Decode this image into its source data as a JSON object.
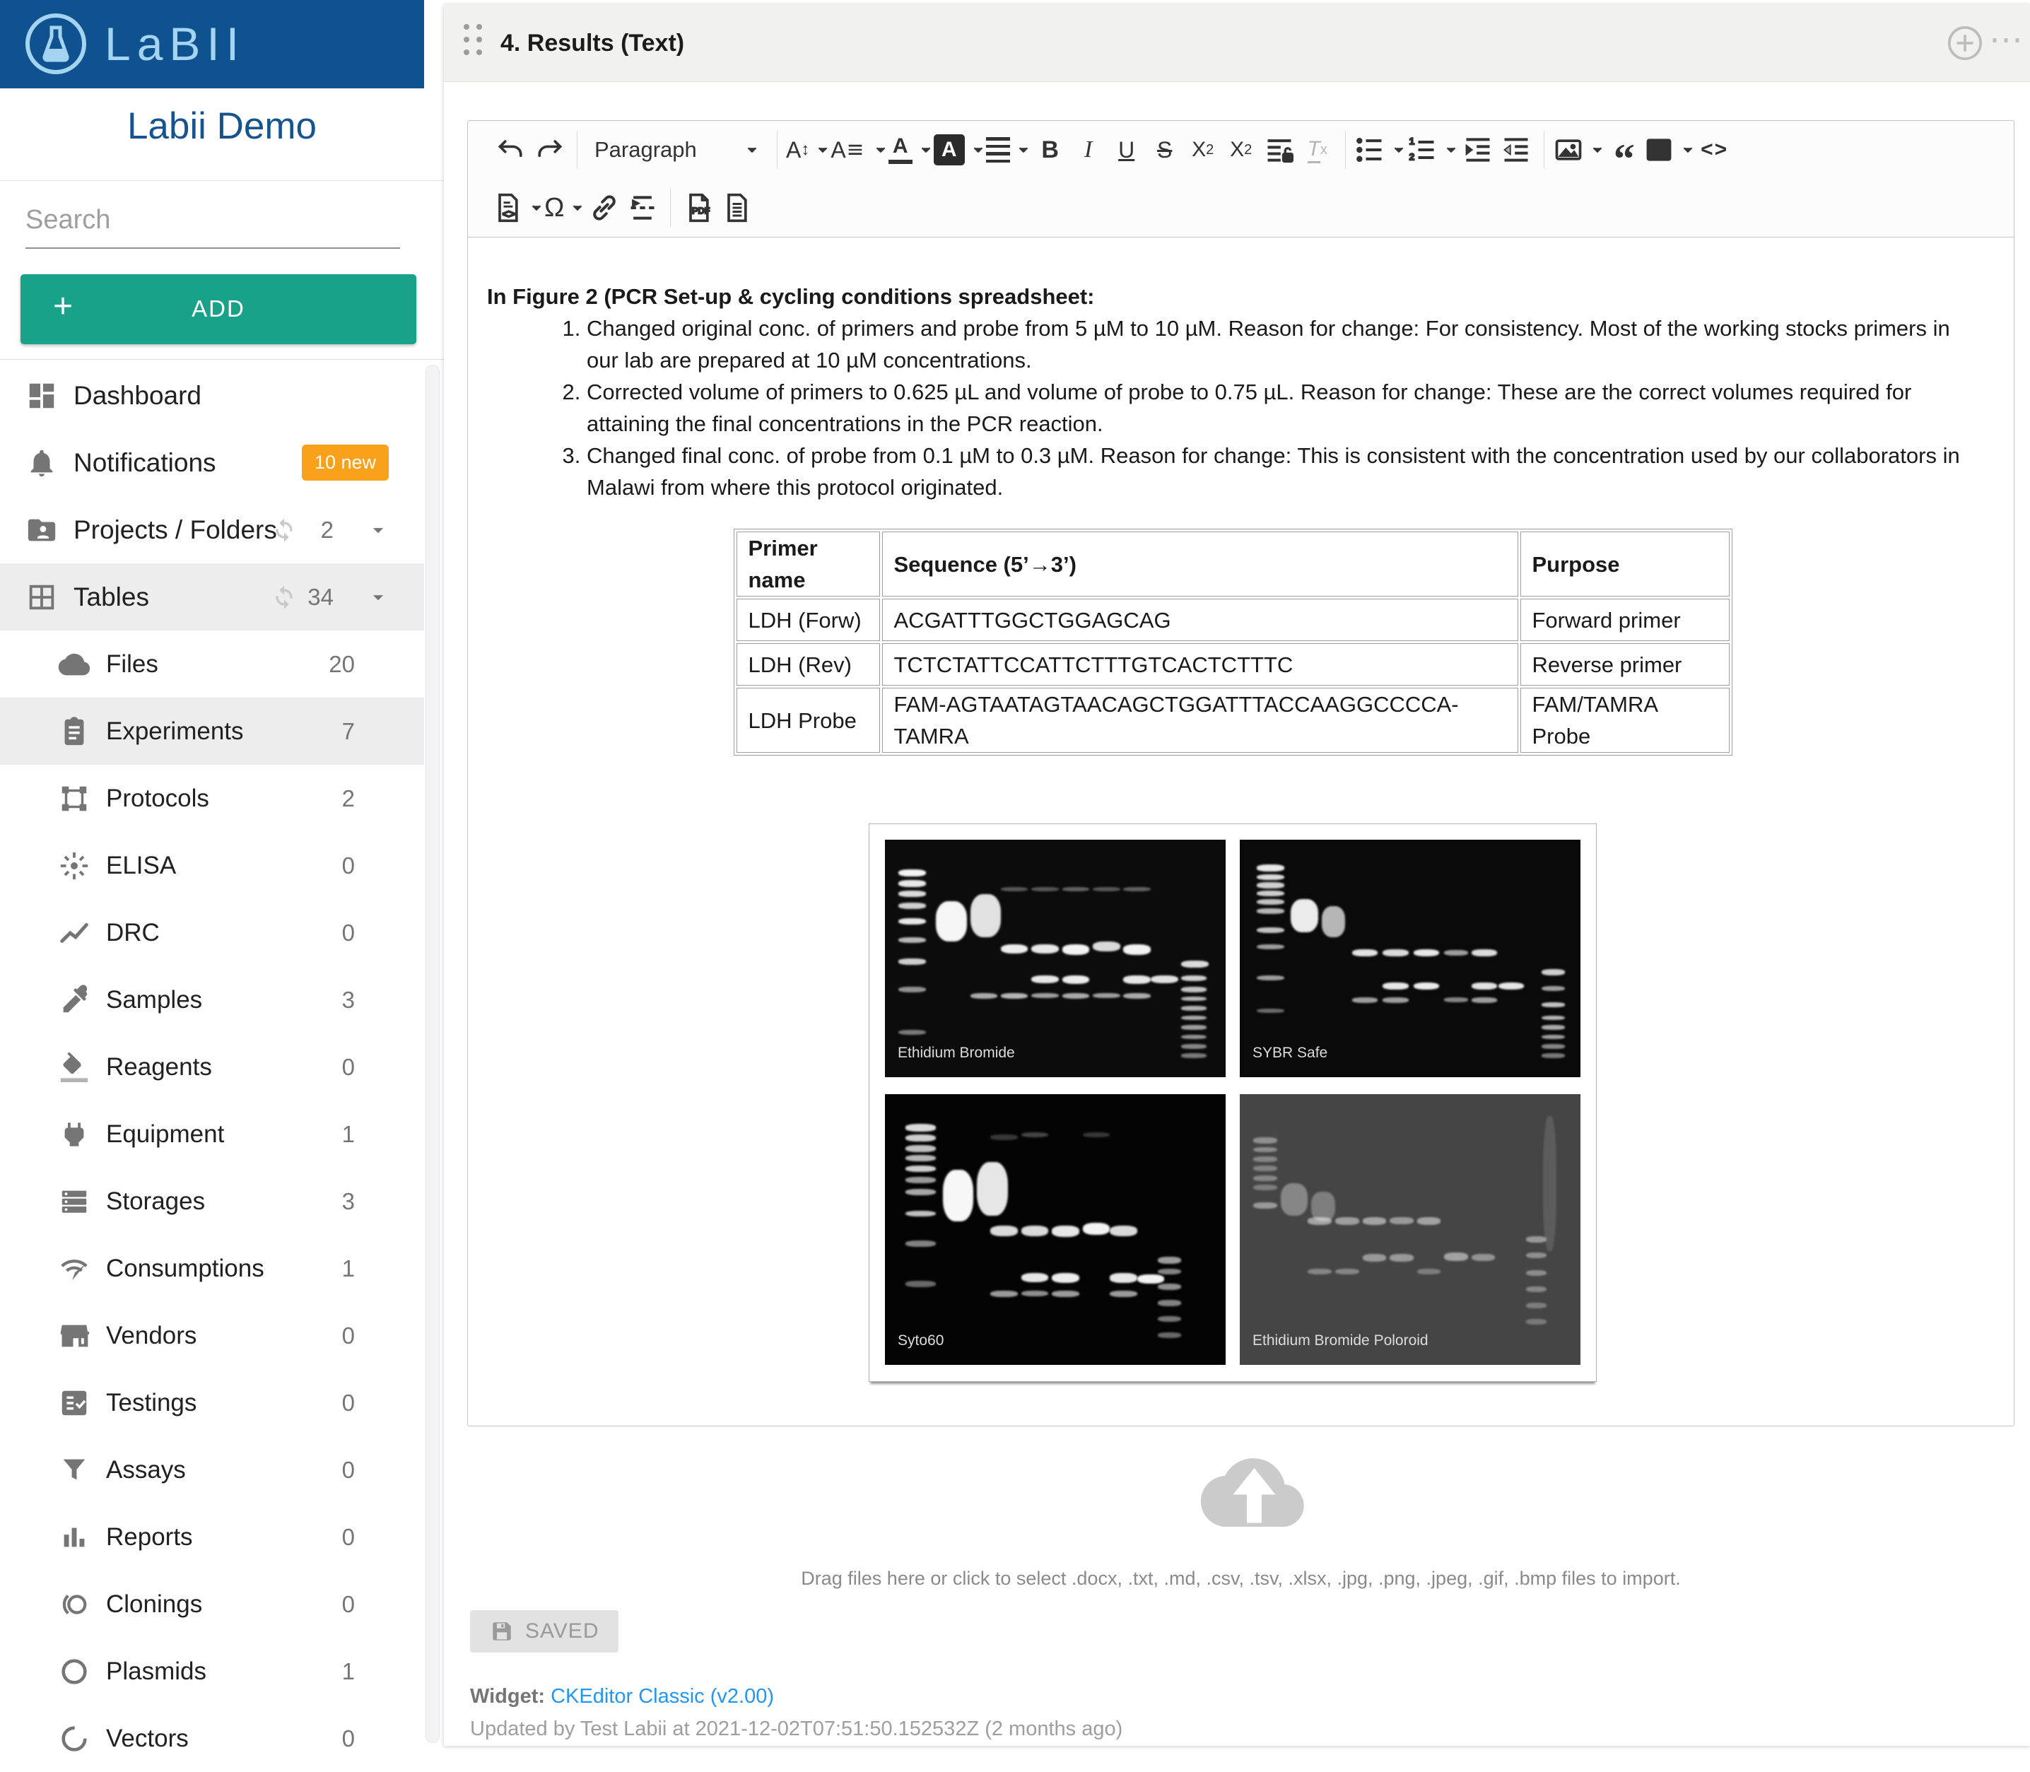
{
  "sidebar": {
    "logo_text": "LaBII",
    "workspace_name": "Labii Demo",
    "search_placeholder": "Search",
    "add_button": "ADD",
    "items": [
      {
        "label": "Dashboard"
      },
      {
        "label": "Notifications",
        "badge": "10 new"
      },
      {
        "label": "Projects / Folders",
        "count": "2"
      },
      {
        "label": "Tables",
        "count": "34"
      },
      {
        "label": "Files",
        "count": "20"
      },
      {
        "label": "Experiments",
        "count": "7"
      },
      {
        "label": "Protocols",
        "count": "2"
      },
      {
        "label": "ELISA",
        "count": "0"
      },
      {
        "label": "DRC",
        "count": "0"
      },
      {
        "label": "Samples",
        "count": "3"
      },
      {
        "label": "Reagents",
        "count": "0"
      },
      {
        "label": "Equipment",
        "count": "1"
      },
      {
        "label": "Storages",
        "count": "3"
      },
      {
        "label": "Consumptions",
        "count": "1"
      },
      {
        "label": "Vendors",
        "count": "0"
      },
      {
        "label": "Testings",
        "count": "0"
      },
      {
        "label": "Assays",
        "count": "0"
      },
      {
        "label": "Reports",
        "count": "0"
      },
      {
        "label": "Clonings",
        "count": "0"
      },
      {
        "label": "Plasmids",
        "count": "1"
      },
      {
        "label": "Vectors",
        "count": "0"
      }
    ]
  },
  "widget": {
    "title": "4. Results (Text)",
    "toolbar": {
      "style_label": "Paragraph"
    },
    "content": {
      "heading": "In Figure 2 (PCR Set-up & cycling conditions spreadsheet:",
      "list_items": [
        "Changed original conc. of primers and probe from 5 µM to 10 µM. Reason for change: For consistency. Most of the working stocks primers in our lab are prepared at 10 µM concentrations.",
        "Corrected volume of primers to 0.625 µL and volume of probe to 0.75 µL. Reason for change: These are the correct volumes required for attaining the final concentrations in the PCR reaction.",
        "Changed final conc. of probe from 0.1 µM to 0.3 µM. Reason for change: This is consistent with the concentration used by our collaborators in Malawi from where this protocol originated."
      ],
      "table": {
        "headers": [
          "Primer name",
          "Sequence (5’→3’)",
          "Purpose"
        ],
        "rows": [
          [
            "LDH (Forw)",
            "ACGATTTGGCTGGAGCAG",
            "Forward primer"
          ],
          [
            "LDH (Rev)",
            "TCTCTATTCCATTCTTTGTCACTCTTTC",
            "Reverse primer"
          ],
          [
            "LDH Probe",
            "FAM-AGTAATAGTAACAGCTGGATTTACCAAGGCCCCA-TAMRA",
            "FAM/TAMRA Probe"
          ]
        ]
      },
      "gel_labels": [
        "Ethidium Bromide",
        "SYBR Safe",
        "Syto60",
        "Ethidium Bromide Poloroid"
      ]
    },
    "upload_hint": "Drag files here or click to select .docx, .txt, .md, .csv, .tsv, .xlsx, .jpg, .png, .jpeg, .gif, .bmp files to import.",
    "save_status": "SAVED",
    "footer": {
      "widget_label": "Widget:",
      "widget_link": "CKEditor Classic (v2.00)",
      "updated_text": "Updated by Test Labii at 2021-12-02T07:51:50.152532Z (2 months ago)"
    }
  },
  "colors": {
    "brand_blue": "#0E538F",
    "accent_teal": "#17A289",
    "badge_orange": "#F9A11B",
    "link_blue": "#2196F3"
  }
}
